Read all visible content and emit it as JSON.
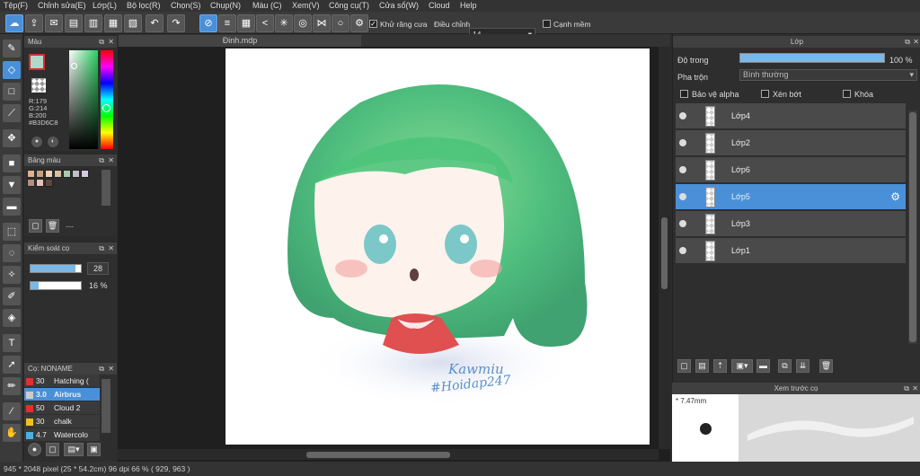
{
  "menu": [
    "Tệp(F)",
    "Chỉnh sửa(E)",
    "Lớp(L)",
    "Bộ lọc(R)",
    "Chọn(S)",
    "Chụp(N)",
    "Màu (C)",
    "Xem(V)",
    "Công cụ(T)",
    "Cửa sổ(W)",
    "Cloud",
    "Help"
  ],
  "toolbar": {
    "antialias_label": "Khử răng cưa",
    "adjust_label": "Điều chỉnh",
    "adjust_value": "14",
    "smooth_label": "Cạnh mềm"
  },
  "color_panel": {
    "title": "Màu",
    "r": "R:179",
    "g": "G:214",
    "b": "B:200",
    "hex": "#B3D6C8",
    "fg": "#B3D6C8",
    "swatch_border": "#d03030"
  },
  "palette_panel": {
    "title": "Bảng màu",
    "colors": [
      "#e0b090",
      "#c8a080",
      "#f0d0b0",
      "#d8c0a0",
      "#a8c8b0",
      "#c0c0c8",
      "#d8c8e0",
      "#b09080",
      "#e8c0b8",
      "#604840"
    ],
    "more": "---"
  },
  "brush_control": {
    "title": "Kiểm soát cọ",
    "size": "28",
    "opacity": "16 %",
    "size_fill": 0.9,
    "opacity_fill": 0.16
  },
  "brush_panel": {
    "title": "Cọ: NONAME",
    "items": [
      {
        "size": "30",
        "name": "Hatching (",
        "color": "#e03030"
      },
      {
        "size": "3.0",
        "name": "Airbrus",
        "color": "#cccccc"
      },
      {
        "size": "50",
        "name": "Cloud 2",
        "color": "#e03030"
      },
      {
        "size": "30",
        "name": "chalk",
        "color": "#f0c020"
      },
      {
        "size": "4.7",
        "name": "Watercolo",
        "color": "#4ab0e0"
      }
    ]
  },
  "canvas": {
    "tab": "Đinh.mdp",
    "signature1": "Kawmiu",
    "signature2": "#Hoidap247"
  },
  "layers_panel": {
    "title": "Lớp",
    "opacity_label": "Độ trong",
    "opacity_value": "100 %",
    "opacity_fill": 1.0,
    "blend_label": "Pha trộn",
    "blend_value": "Bình thường",
    "protect_alpha": "Bảo vệ alpha",
    "clipping": "Xén bớt",
    "lock": "Khóa",
    "layers": [
      "Lớp4",
      "Lớp2",
      "Lớp6",
      "Lớp5",
      "Lớp3",
      "Lớp1"
    ],
    "selected": "Lớp5"
  },
  "preview_panel": {
    "title": "Xem trước cọ",
    "size": "* 7.47mm"
  },
  "status": "945 * 2048 pixel  (25 * 54.2cm)  96 dpi  66 %  ( 929, 963 )"
}
